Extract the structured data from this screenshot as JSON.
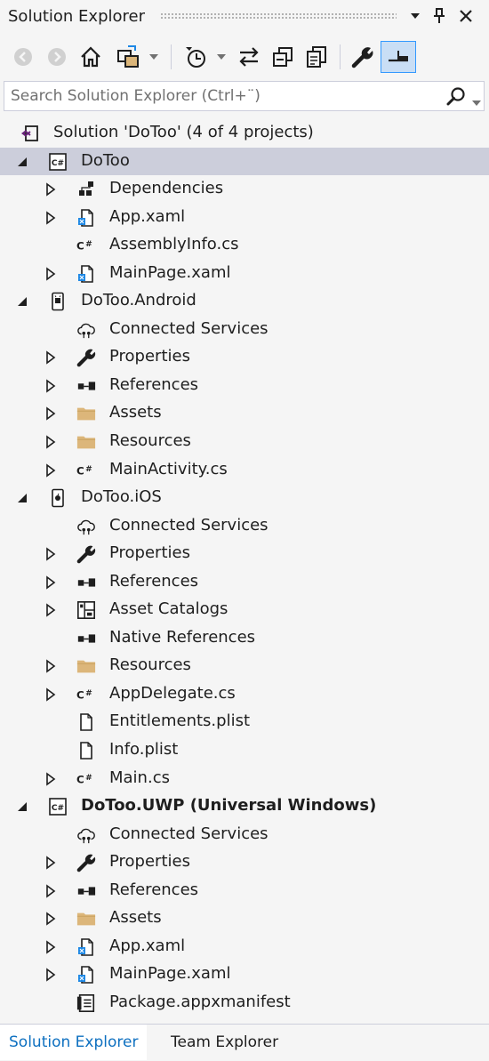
{
  "window": {
    "title": "Solution Explorer"
  },
  "titlebar_buttons": [
    "dropdown-arrow-icon",
    "pin-icon",
    "close-icon"
  ],
  "toolbar": {
    "buttons": [
      "back-icon",
      "forward-icon",
      "home-icon",
      "switch-views-icon",
      "dropdown-arrow-icon",
      "pending-changes-filter-icon",
      "dropdown-arrow-icon",
      "sync-active-document-icon",
      "collapse-all-icon",
      "show-all-files-icon",
      "properties-wrench-icon",
      "preview-selected-items-icon"
    ]
  },
  "search": {
    "placeholder": "Search Solution Explorer (Ctrl+¨)"
  },
  "tree": [
    {
      "label": "Solution 'DoToo' (4 of 4 projects)",
      "level": 0,
      "expander": "none",
      "icon": "solution-icon"
    },
    {
      "label": "DoToo",
      "level": 1,
      "expander": "expanded",
      "icon": "csharp-project-icon",
      "selected": true
    },
    {
      "label": "Dependencies",
      "level": 2,
      "expander": "collapsed",
      "icon": "dependencies-icon"
    },
    {
      "label": "App.xaml",
      "level": 2,
      "expander": "collapsed",
      "icon": "xaml-file-icon"
    },
    {
      "label": "AssemblyInfo.cs",
      "level": 2,
      "expander": "none",
      "icon": "csharp-file-icon"
    },
    {
      "label": "MainPage.xaml",
      "level": 2,
      "expander": "collapsed",
      "icon": "xaml-file-icon"
    },
    {
      "label": "DoToo.Android",
      "level": 1,
      "expander": "expanded",
      "icon": "android-project-icon"
    },
    {
      "label": "Connected Services",
      "level": 2,
      "expander": "none",
      "icon": "connected-services-icon"
    },
    {
      "label": "Properties",
      "level": 2,
      "expander": "collapsed",
      "icon": "wrench-icon"
    },
    {
      "label": "References",
      "level": 2,
      "expander": "collapsed",
      "icon": "references-icon"
    },
    {
      "label": "Assets",
      "level": 2,
      "expander": "collapsed",
      "icon": "folder-icon"
    },
    {
      "label": "Resources",
      "level": 2,
      "expander": "collapsed",
      "icon": "folder-icon"
    },
    {
      "label": "MainActivity.cs",
      "level": 2,
      "expander": "collapsed",
      "icon": "csharp-file-icon"
    },
    {
      "label": "DoToo.iOS",
      "level": 1,
      "expander": "expanded",
      "icon": "ios-project-icon"
    },
    {
      "label": "Connected Services",
      "level": 2,
      "expander": "none",
      "icon": "connected-services-icon"
    },
    {
      "label": "Properties",
      "level": 2,
      "expander": "collapsed",
      "icon": "wrench-icon"
    },
    {
      "label": "References",
      "level": 2,
      "expander": "collapsed",
      "icon": "references-icon"
    },
    {
      "label": "Asset Catalogs",
      "level": 2,
      "expander": "collapsed",
      "icon": "asset-catalog-icon"
    },
    {
      "label": "Native References",
      "level": 2,
      "expander": "none",
      "icon": "references-icon"
    },
    {
      "label": "Resources",
      "level": 2,
      "expander": "collapsed",
      "icon": "folder-icon"
    },
    {
      "label": "AppDelegate.cs",
      "level": 2,
      "expander": "collapsed",
      "icon": "csharp-file-icon"
    },
    {
      "label": "Entitlements.plist",
      "level": 2,
      "expander": "none",
      "icon": "file-icon"
    },
    {
      "label": "Info.plist",
      "level": 2,
      "expander": "none",
      "icon": "file-icon"
    },
    {
      "label": "Main.cs",
      "level": 2,
      "expander": "collapsed",
      "icon": "csharp-file-icon"
    },
    {
      "label": "DoToo.UWP (Universal Windows)",
      "level": 1,
      "expander": "expanded",
      "icon": "csharp-project-icon",
      "bold": true
    },
    {
      "label": "Connected Services",
      "level": 2,
      "expander": "none",
      "icon": "connected-services-icon"
    },
    {
      "label": "Properties",
      "level": 2,
      "expander": "collapsed",
      "icon": "wrench-icon"
    },
    {
      "label": "References",
      "level": 2,
      "expander": "collapsed",
      "icon": "references-icon"
    },
    {
      "label": "Assets",
      "level": 2,
      "expander": "collapsed",
      "icon": "folder-icon"
    },
    {
      "label": "App.xaml",
      "level": 2,
      "expander": "collapsed",
      "icon": "xaml-file-icon"
    },
    {
      "label": "MainPage.xaml",
      "level": 2,
      "expander": "collapsed",
      "icon": "xaml-file-icon"
    },
    {
      "label": "Package.appxmanifest",
      "level": 2,
      "expander": "none",
      "icon": "manifest-icon"
    }
  ],
  "tabs": [
    {
      "label": "Solution Explorer",
      "active": true
    },
    {
      "label": "Team Explorer",
      "active": false
    }
  ],
  "colors": {
    "background": "#f5f5f5",
    "selected_row": "#cccedb",
    "active_tab_text": "#0e70c0",
    "csharp_icon": "#68217a",
    "folder": "#dcb67a",
    "accent": "#3399ff"
  }
}
